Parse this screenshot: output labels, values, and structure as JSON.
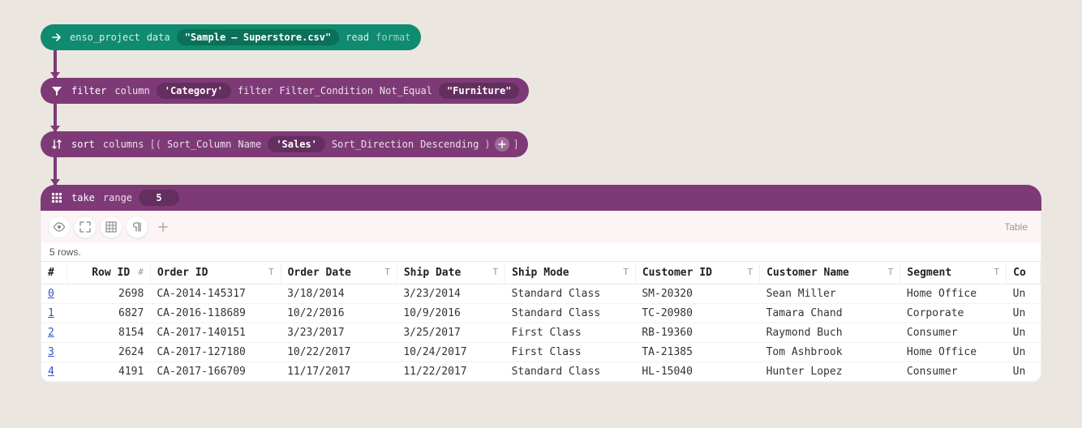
{
  "nodes": {
    "read": {
      "prefix": "enso_project",
      "method": "data",
      "arg": "\"Sample – Superstore.csv\"",
      "op": "read",
      "param": "format"
    },
    "filter": {
      "op": "filter",
      "column_kw": "column",
      "column_val": "'Category'",
      "filter_kw": "filter",
      "cond_type": "Filter_Condition",
      "cond_op": "Not_Equal",
      "cond_val": "\"Furniture\""
    },
    "sort": {
      "op": "sort",
      "columns_kw": "columns",
      "sc_type": "Sort_Column",
      "name_kw": "Name",
      "name_val": "'Sales'",
      "dir_type": "Sort_Direction",
      "dir_val": "Descending"
    },
    "take": {
      "op": "take",
      "range_kw": "range",
      "range_val": "5"
    }
  },
  "output": {
    "type_label": "Table",
    "rows_text": "5 rows.",
    "columns": [
      {
        "name": "#",
        "type": ""
      },
      {
        "name": "Row ID",
        "type": "#"
      },
      {
        "name": "Order ID",
        "type": "T"
      },
      {
        "name": "Order Date",
        "type": "T"
      },
      {
        "name": "Ship Date",
        "type": "T"
      },
      {
        "name": "Ship Mode",
        "type": "T"
      },
      {
        "name": "Customer ID",
        "type": "T"
      },
      {
        "name": "Customer Name",
        "type": "T"
      },
      {
        "name": "Segment",
        "type": "T"
      },
      {
        "name": "Co",
        "type": ""
      }
    ],
    "rows": [
      {
        "idx": "0",
        "row_id": "2698",
        "order_id": "CA-2014-145317",
        "order_date": "3/18/2014",
        "ship_date": "3/23/2014",
        "ship_mode": "Standard Class",
        "customer_id": "SM-20320",
        "customer_name": "Sean Miller",
        "segment": "Home Office",
        "co": "Un"
      },
      {
        "idx": "1",
        "row_id": "6827",
        "order_id": "CA-2016-118689",
        "order_date": "10/2/2016",
        "ship_date": "10/9/2016",
        "ship_mode": "Standard Class",
        "customer_id": "TC-20980",
        "customer_name": "Tamara Chand",
        "segment": "Corporate",
        "co": "Un"
      },
      {
        "idx": "2",
        "row_id": "8154",
        "order_id": "CA-2017-140151",
        "order_date": "3/23/2017",
        "ship_date": "3/25/2017",
        "ship_mode": "First Class",
        "customer_id": "RB-19360",
        "customer_name": "Raymond Buch",
        "segment": "Consumer",
        "co": "Un"
      },
      {
        "idx": "3",
        "row_id": "2624",
        "order_id": "CA-2017-127180",
        "order_date": "10/22/2017",
        "ship_date": "10/24/2017",
        "ship_mode": "First Class",
        "customer_id": "TA-21385",
        "customer_name": "Tom Ashbrook",
        "segment": "Home Office",
        "co": "Un"
      },
      {
        "idx": "4",
        "row_id": "4191",
        "order_id": "CA-2017-166709",
        "order_date": "11/17/2017",
        "ship_date": "11/22/2017",
        "ship_mode": "Standard Class",
        "customer_id": "HL-15040",
        "customer_name": "Hunter Lopez",
        "segment": "Consumer",
        "co": "Un"
      }
    ]
  }
}
